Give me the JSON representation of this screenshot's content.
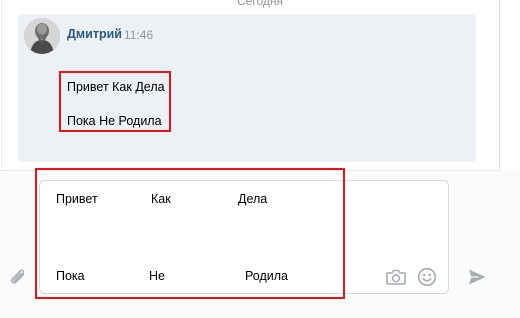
{
  "conversation": {
    "date_separator": "Сегодня"
  },
  "message": {
    "author": "Дмитрий",
    "time": "11:46",
    "lines": [
      "Привет Как Дела",
      "Пока Не Родила"
    ]
  },
  "composer": {
    "row1": [
      "Привет",
      "Как",
      "Дела"
    ],
    "row2": [
      "Пока",
      "Не",
      "Родила"
    ]
  },
  "icons": {
    "attach": "paperclip-icon",
    "camera": "camera-icon",
    "emoji": "smile-icon",
    "send": "send-icon"
  },
  "colors": {
    "author_link": "#2a5885",
    "highlight_frame": "#e3151a",
    "message_background": "#edf0f5",
    "icon_gray": "#a6acb3"
  }
}
